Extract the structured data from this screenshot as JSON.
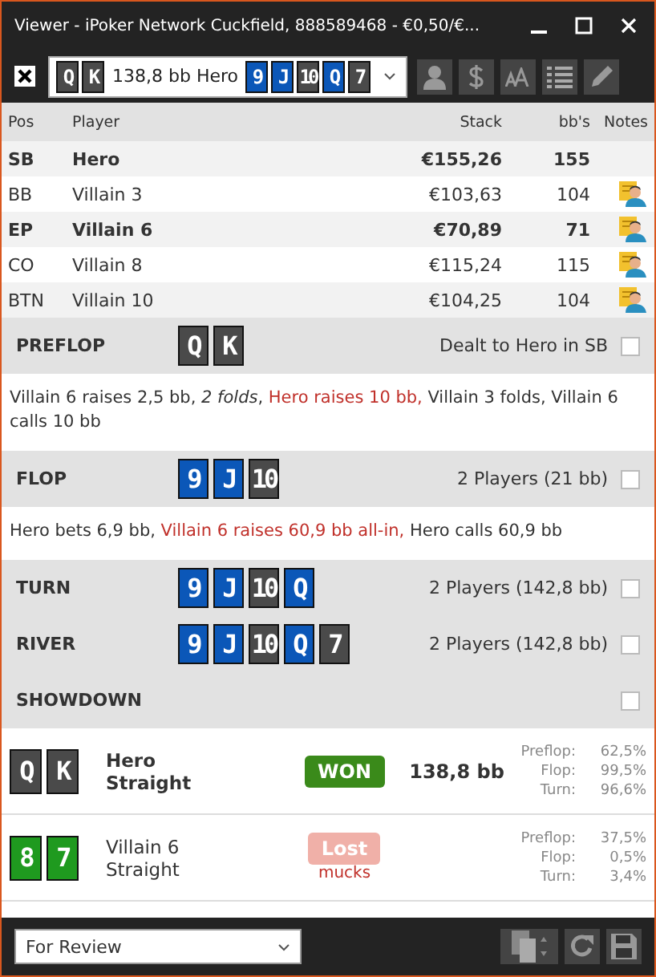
{
  "window": {
    "title": "Viewer - iPoker Network Cuckfield, 888589468 - €0,50/€..."
  },
  "toolbar": {
    "hero_cards": [
      {
        "rank": "Q",
        "color": "#4a4a4a"
      },
      {
        "rank": "K",
        "color": "#4a4a4a"
      }
    ],
    "summary": "138,8 bb Hero",
    "board": [
      {
        "rank": "9",
        "color": "#0b57b8"
      },
      {
        "rank": "J",
        "color": "#0b57b8"
      },
      {
        "rank": "10",
        "color": "#4a4a4a"
      },
      {
        "rank": "Q",
        "color": "#0b57b8"
      },
      {
        "rank": "7",
        "color": "#4a4a4a"
      }
    ]
  },
  "table": {
    "columns": [
      "Pos",
      "Player",
      "Stack",
      "bb's",
      "Notes"
    ],
    "rows": [
      {
        "pos": "SB",
        "player": "Hero",
        "stack": "€155,26",
        "bbs": "155",
        "bold": true,
        "has_note": false
      },
      {
        "pos": "BB",
        "player": "Villain 3",
        "stack": "€103,63",
        "bbs": "104",
        "bold": false,
        "has_note": true
      },
      {
        "pos": "EP",
        "player": "Villain 6",
        "stack": "€70,89",
        "bbs": "71",
        "bold": true,
        "has_note": true
      },
      {
        "pos": "CO",
        "player": "Villain 8",
        "stack": "€115,24",
        "bbs": "115",
        "bold": false,
        "has_note": true
      },
      {
        "pos": "BTN",
        "player": "Villain 10",
        "stack": "€104,25",
        "bbs": "104",
        "bold": false,
        "has_note": true
      }
    ]
  },
  "streets": [
    {
      "name": "PREFLOP",
      "cards": [
        {
          "rank": "Q",
          "color": "#4a4a4a"
        },
        {
          "rank": "K",
          "color": "#4a4a4a"
        }
      ],
      "info": "Dealt to Hero in SB",
      "checked": false,
      "actions": [
        {
          "text": "Villain 6 raises 2,5 bb, *2 folds*, ",
          "highlight": false
        },
        {
          "text": "Hero raises 10 bb,",
          "highlight": true
        },
        {
          "text": " Villain 3 folds, Villain 6 calls 10 bb",
          "highlight": false
        }
      ]
    },
    {
      "name": "FLOP",
      "cards": [
        {
          "rank": "9",
          "color": "#0b57b8"
        },
        {
          "rank": "J",
          "color": "#0b57b8"
        },
        {
          "rank": "10",
          "color": "#4a4a4a"
        }
      ],
      "info": "2 Players (21 bb)",
      "checked": false,
      "actions": [
        {
          "text": "Hero bets 6,9 bb, ",
          "highlight": false
        },
        {
          "text": "Villain 6 raises 60,9 bb all-in,",
          "highlight": true
        },
        {
          "text": " Hero calls 60,9 bb",
          "highlight": false
        }
      ]
    },
    {
      "name": "TURN",
      "cards": [
        {
          "rank": "9",
          "color": "#0b57b8"
        },
        {
          "rank": "J",
          "color": "#0b57b8"
        },
        {
          "rank": "10",
          "color": "#4a4a4a"
        },
        {
          "rank": "Q",
          "color": "#0b57b8"
        }
      ],
      "info": "2 Players (142,8 bb)",
      "checked": false
    },
    {
      "name": "RIVER",
      "cards": [
        {
          "rank": "9",
          "color": "#0b57b8"
        },
        {
          "rank": "J",
          "color": "#0b57b8"
        },
        {
          "rank": "10",
          "color": "#4a4a4a"
        },
        {
          "rank": "Q",
          "color": "#0b57b8"
        },
        {
          "rank": "7",
          "color": "#4a4a4a"
        }
      ],
      "info": "2 Players (142,8 bb)",
      "checked": false
    },
    {
      "name": "SHOWDOWN",
      "checked": false
    }
  ],
  "results": [
    {
      "cards": [
        {
          "rank": "Q",
          "color": "#4a4a4a"
        },
        {
          "rank": "K",
          "color": "#4a4a4a"
        }
      ],
      "player": "Hero",
      "hand": "Straight",
      "bold": true,
      "result": {
        "kind": "won",
        "label": "WON"
      },
      "amount": "138,8 bb",
      "equity": [
        {
          "label": "Preflop:",
          "value": "62,5%"
        },
        {
          "label": "Flop:",
          "value": "99,5%"
        },
        {
          "label": "Turn:",
          "value": "96,6%"
        }
      ]
    },
    {
      "cards": [
        {
          "rank": "8",
          "color": "#1f9a1f"
        },
        {
          "rank": "7",
          "color": "#1f9a1f"
        }
      ],
      "player": "Villain 6",
      "hand": "Straight",
      "bold": false,
      "result": {
        "kind": "lost",
        "label": "Lost"
      },
      "note": "mucks",
      "equity": [
        {
          "label": "Preflop:",
          "value": "37,5%"
        },
        {
          "label": "Flop:",
          "value": "0,5%"
        },
        {
          "label": "Turn:",
          "value": "3,4%"
        }
      ]
    }
  ],
  "footer": {
    "filter": "For Review"
  }
}
